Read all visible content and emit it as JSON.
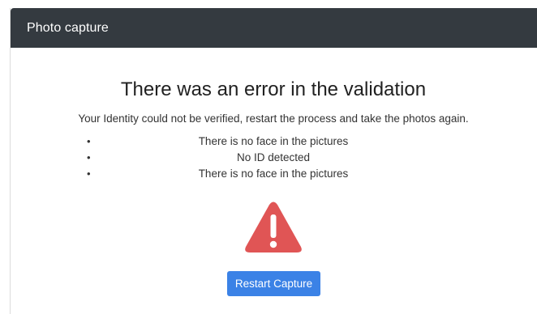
{
  "header": {
    "title": "Photo capture"
  },
  "error": {
    "title": "There was an error in the validation",
    "message": "Your Identity could not be verified, restart the process and take the photos again.",
    "reasons": [
      "There is no face in the pictures",
      "No ID detected",
      "There is no face in the pictures"
    ],
    "icon": "warning-triangle-icon",
    "icon_color": "#e05555"
  },
  "actions": {
    "restart_label": "Restart Capture",
    "button_color": "#3b82e6"
  },
  "colors": {
    "header_bg": "#343a40"
  }
}
